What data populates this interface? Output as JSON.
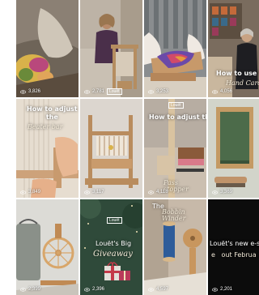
{
  "tiles": [
    {
      "views": "3,826"
    },
    {
      "views": "2,781",
      "badge": "Louët"
    },
    {
      "views": "3,253"
    },
    {
      "views": "4,056",
      "title": "How to use th",
      "script": "Hand Card"
    },
    {
      "views": "3,849",
      "title": "How to adjust\nthe",
      "script": "Beater bar"
    },
    {
      "views": "3,117"
    },
    {
      "views": "4,118",
      "badge": "Louët",
      "title": "How to adjust the",
      "script": "Pass\nstopper"
    },
    {
      "views": "3,369"
    },
    {
      "views": "2,399"
    },
    {
      "views": "2,396",
      "badge": "Louët",
      "title": "Louët's Big",
      "script": "Giveaway"
    },
    {
      "views": "4,597",
      "title": "The",
      "script": "Bobbin\nWinder"
    },
    {
      "views": "2,201",
      "title": "Louët's new e-sp",
      "script": "e   out Februa"
    }
  ],
  "icons": {
    "views": "eye-icon"
  }
}
